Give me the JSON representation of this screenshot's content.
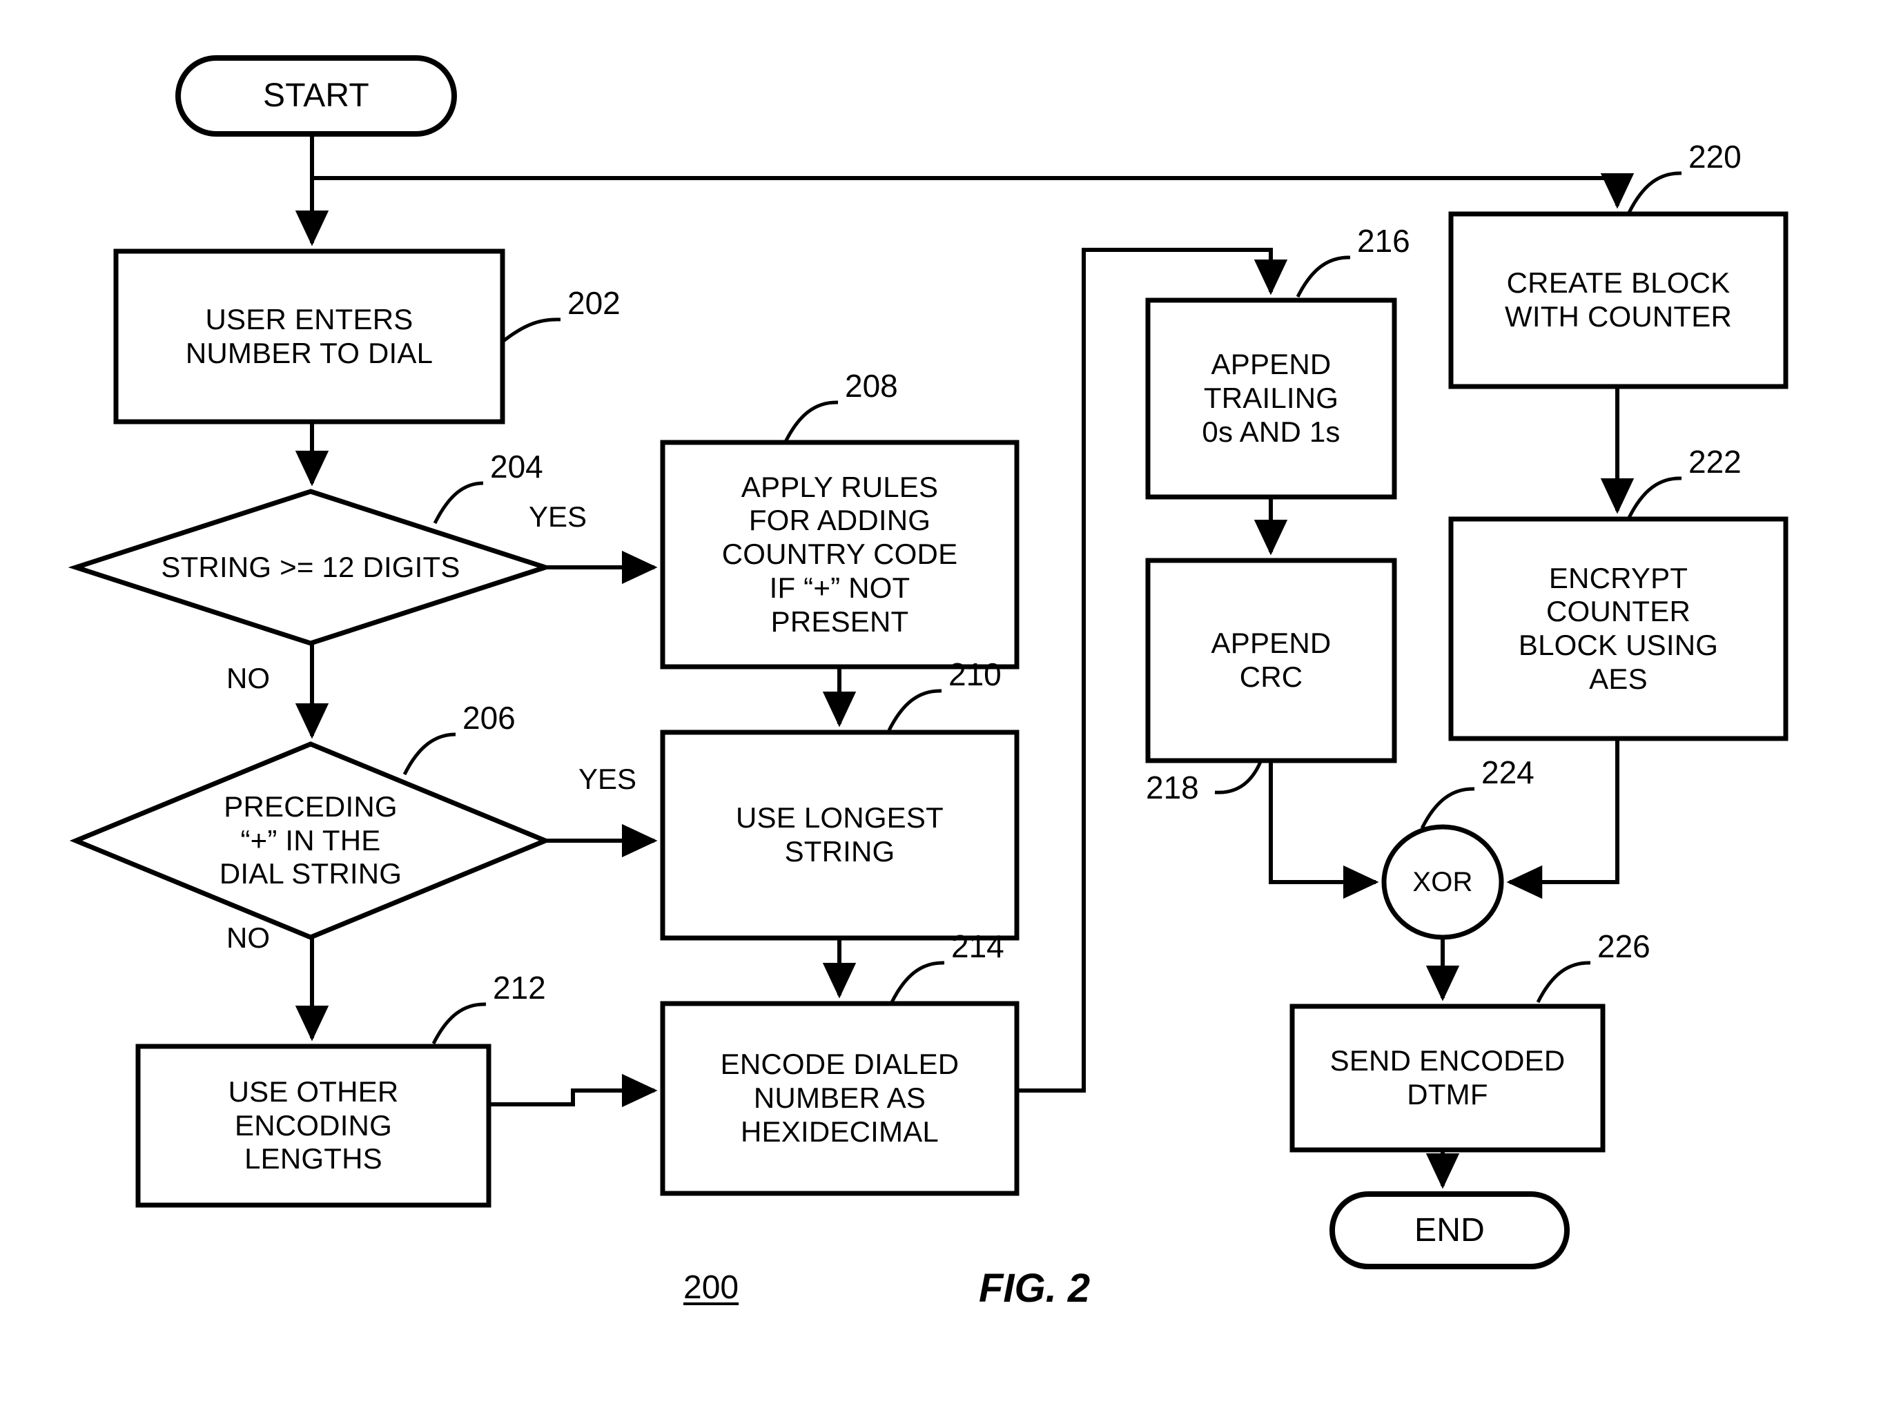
{
  "figure": {
    "caption": "FIG. 2",
    "number": "200"
  },
  "nodes": {
    "start": {
      "label": "START",
      "shape": "terminator",
      "ref": ""
    },
    "n202": {
      "label": "USER ENTERS\nNUMBER TO DIAL",
      "shape": "process",
      "ref": "202"
    },
    "n204": {
      "label": "STRING >= 12 DIGITS",
      "shape": "decision",
      "ref": "204"
    },
    "n206": {
      "label": "PRECEDING\n“+” IN THE\nDIAL STRING",
      "shape": "decision",
      "ref": "206"
    },
    "n208": {
      "label": "APPLY RULES\nFOR ADDING\nCOUNTRY CODE\nIF “+” NOT\nPRESENT",
      "shape": "process",
      "ref": "208"
    },
    "n210": {
      "label": "USE LONGEST\nSTRING",
      "shape": "process",
      "ref": "210"
    },
    "n212": {
      "label": "USE OTHER\nENCODING\nLENGTHS",
      "shape": "process",
      "ref": "212"
    },
    "n214": {
      "label": "ENCODE DIALED\nNUMBER AS\nHEXIDECIMAL",
      "shape": "process",
      "ref": "214"
    },
    "n216": {
      "label": "APPEND\nTRAILING\n0s AND 1s",
      "shape": "process",
      "ref": "216"
    },
    "n218": {
      "label": "APPEND\nCRC",
      "shape": "process",
      "ref": "218"
    },
    "n220": {
      "label": "CREATE BLOCK\nWITH COUNTER",
      "shape": "process",
      "ref": "220"
    },
    "n222": {
      "label": "ENCRYPT\nCOUNTER\nBLOCK USING\nAES",
      "shape": "process",
      "ref": "222"
    },
    "n224": {
      "label": "XOR",
      "shape": "circle",
      "ref": "224"
    },
    "n226": {
      "label": "SEND ENCODED\nDTMF",
      "shape": "process",
      "ref": "226"
    },
    "end": {
      "label": "END",
      "shape": "terminator",
      "ref": ""
    }
  },
  "edge_labels": {
    "yes_204": "YES",
    "no_204": "NO",
    "yes_206": "YES",
    "no_206": "NO"
  },
  "colors": {
    "stroke": "#000000",
    "background": "#ffffff",
    "text": "#000000"
  }
}
